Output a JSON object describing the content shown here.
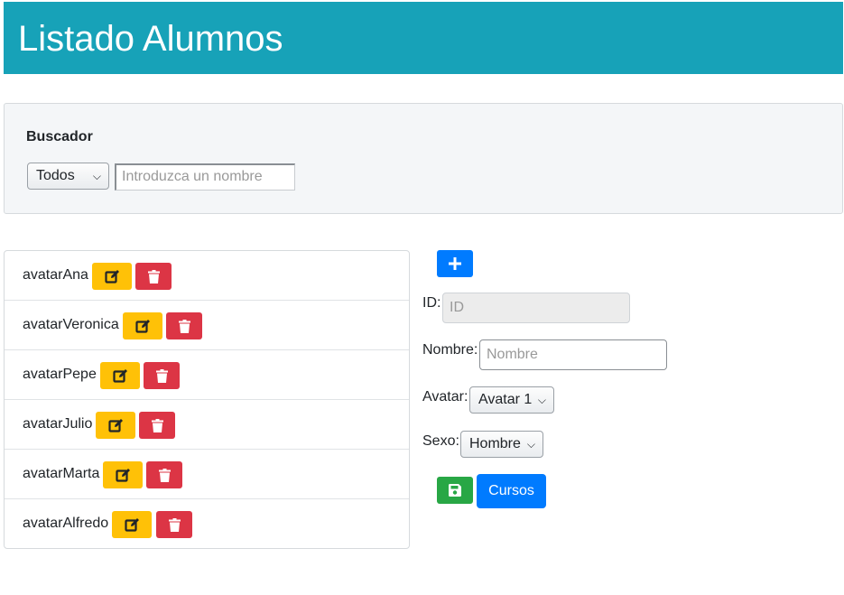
{
  "header": {
    "title": "Listado Alumnos"
  },
  "search": {
    "title": "Buscador",
    "filter_selected": "Todos",
    "name_placeholder": "Introduzca un nombre"
  },
  "students": [
    {
      "label": "avatarAna"
    },
    {
      "label": "avatarVeronica"
    },
    {
      "label": "avatarPepe"
    },
    {
      "label": "avatarJulio"
    },
    {
      "label": "avatarMarta"
    },
    {
      "label": "avatarAlfredo"
    }
  ],
  "form": {
    "id_label": "ID:",
    "id_placeholder": "ID",
    "name_label": "Nombre:",
    "name_placeholder": "Nombre",
    "avatar_label": "Avatar:",
    "avatar_selected": "Avatar 1",
    "sex_label": "Sexo:",
    "sex_selected": "Hombre",
    "cursos_label": "Cursos"
  },
  "icons": {
    "add": "plus-icon",
    "edit": "edit-icon",
    "delete": "trash-icon",
    "save": "save-icon"
  },
  "colors": {
    "header": "#17a2b8",
    "edit": "#ffc107",
    "delete": "#dc3545",
    "primary": "#007bff",
    "save": "#28a745"
  }
}
